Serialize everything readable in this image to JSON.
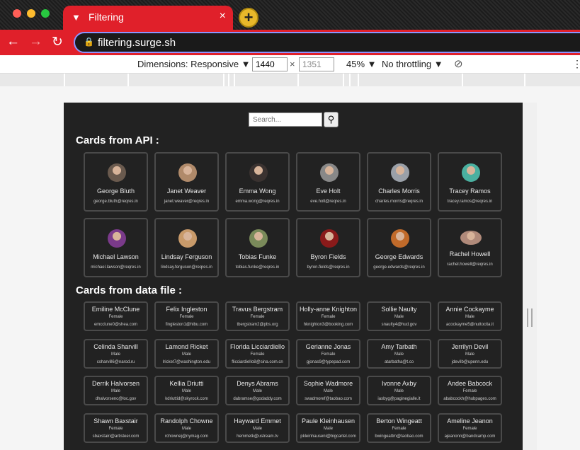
{
  "browser": {
    "tab_title": "Filtering",
    "tab_close": "×",
    "new_tab": "+",
    "url": "filtering.surge.sh"
  },
  "devtools": {
    "dimensions": "Dimensions: Responsive ▼",
    "width": "1440",
    "times": "×",
    "height": "1351",
    "zoom": "45% ▼",
    "throttling": "No throttling ▼",
    "more": "⋮"
  },
  "search": {
    "placeholder": "Search..."
  },
  "api_heading": "Cards from API :",
  "file_heading": "Cards from data file :",
  "api_cards": [
    {
      "name": "George Bluth",
      "email": "george.bluth@reqres.in",
      "color": "#6a5a4e"
    },
    {
      "name": "Janet Weaver",
      "email": "janet.weaver@reqres.in",
      "color": "#b08a6a"
    },
    {
      "name": "Emma Wong",
      "email": "emma.wong@reqres.in",
      "color": "#3a3230"
    },
    {
      "name": "Eve Holt",
      "email": "eve.holt@reqres.in",
      "color": "#888888"
    },
    {
      "name": "Charles Morris",
      "email": "charles.morris@reqres.in",
      "color": "#9aa0a8"
    },
    {
      "name": "Tracey Ramos",
      "email": "tracey.ramos@reqres.in",
      "color": "#4ab0a0"
    },
    {
      "name": "Michael Lawson",
      "email": "michael.lawson@reqres.in",
      "color": "#7a3a8a"
    },
    {
      "name": "Lindsay Ferguson",
      "email": "lindsay.ferguson@reqres.in",
      "color": "#c89a6a"
    },
    {
      "name": "Tobias Funke",
      "email": "tobias.funke@reqres.in",
      "color": "#7a8a5a"
    },
    {
      "name": "Byron Fields",
      "email": "byron.fields@reqres.in",
      "color": "#8a1a1a"
    },
    {
      "name": "George Edwards",
      "email": "george.edwards@reqres.in",
      "color": "#c06a2a"
    },
    {
      "name": "Rachel Howell",
      "email": "rachel.howell@reqres.in",
      "color": "#b08a7a"
    }
  ],
  "file_cards": [
    {
      "name": "Emiline McClune",
      "gender": "Female",
      "email": "emcclune0@shea.com"
    },
    {
      "name": "Felix Ingleston",
      "gender": "Female",
      "email": "fingleston1@hibu.com"
    },
    {
      "name": "Travus Bergstram",
      "gender": "Female",
      "email": "tbergstram2@pbs.org"
    },
    {
      "name": "Holly-anne Knighton",
      "gender": "Female",
      "email": "hknighton3@booking.com"
    },
    {
      "name": "Sollie Naulty",
      "gender": "Male",
      "email": "snaulty4@hud.gov"
    },
    {
      "name": "Annie Cockayme",
      "gender": "Male",
      "email": "acockayme5@nuttocita.it"
    },
    {
      "name": "Celinda Sharvill",
      "gender": "Male",
      "email": "csharvill6@narod.ru"
    },
    {
      "name": "Lamond Ricket",
      "gender": "Male",
      "email": "lricket7@washington.edu"
    },
    {
      "name": "Florida Licciardiello",
      "gender": "Female",
      "email": "flicciardiello8@sina.com.cn"
    },
    {
      "name": "Gerianne Jonas",
      "gender": "Female",
      "email": "gjonas9@typepad.com"
    },
    {
      "name": "Amy Tarbath",
      "gender": "Male",
      "email": "atarbatha@t.co"
    },
    {
      "name": "Jerrilyn Devil",
      "gender": "Male",
      "email": "jdevilb@upenn.edu"
    },
    {
      "name": "Derrik Halvorsen",
      "gender": "Male",
      "email": "dhalvorsenc@loc.gov"
    },
    {
      "name": "Kellia Driutti",
      "gender": "Male",
      "email": "kdriuttid@skyrock.com"
    },
    {
      "name": "Denys Abrams",
      "gender": "Male",
      "email": "dabramse@godaddy.com"
    },
    {
      "name": "Sophie Wadmore",
      "gender": "Male",
      "email": "swadmoref@taobao.com"
    },
    {
      "name": "Ivonne Axby",
      "gender": "Male",
      "email": "iaxbyg@paginegialle.it"
    },
    {
      "name": "Andee Babcock",
      "gender": "Female",
      "email": "ababcockh@hubpages.com"
    },
    {
      "name": "Shawn Baxstair",
      "gender": "Female",
      "email": "sbaxstairi@artisteer.com"
    },
    {
      "name": "Randolph Chowne",
      "gender": "Male",
      "email": "rchownej@nymag.com"
    },
    {
      "name": "Hayward Emmet",
      "gender": "Male",
      "email": "hemmetk@ustream.tv"
    },
    {
      "name": "Paule Kleinhausen",
      "gender": "Male",
      "email": "pkleinhausenl@bigcartel.com"
    },
    {
      "name": "Berton Wingeatt",
      "gender": "Female",
      "email": "bwingeattm@taobao.com"
    },
    {
      "name": "Ameline Jeanon",
      "gender": "Female",
      "email": "ajeanonn@bandcamp.com"
    }
  ]
}
